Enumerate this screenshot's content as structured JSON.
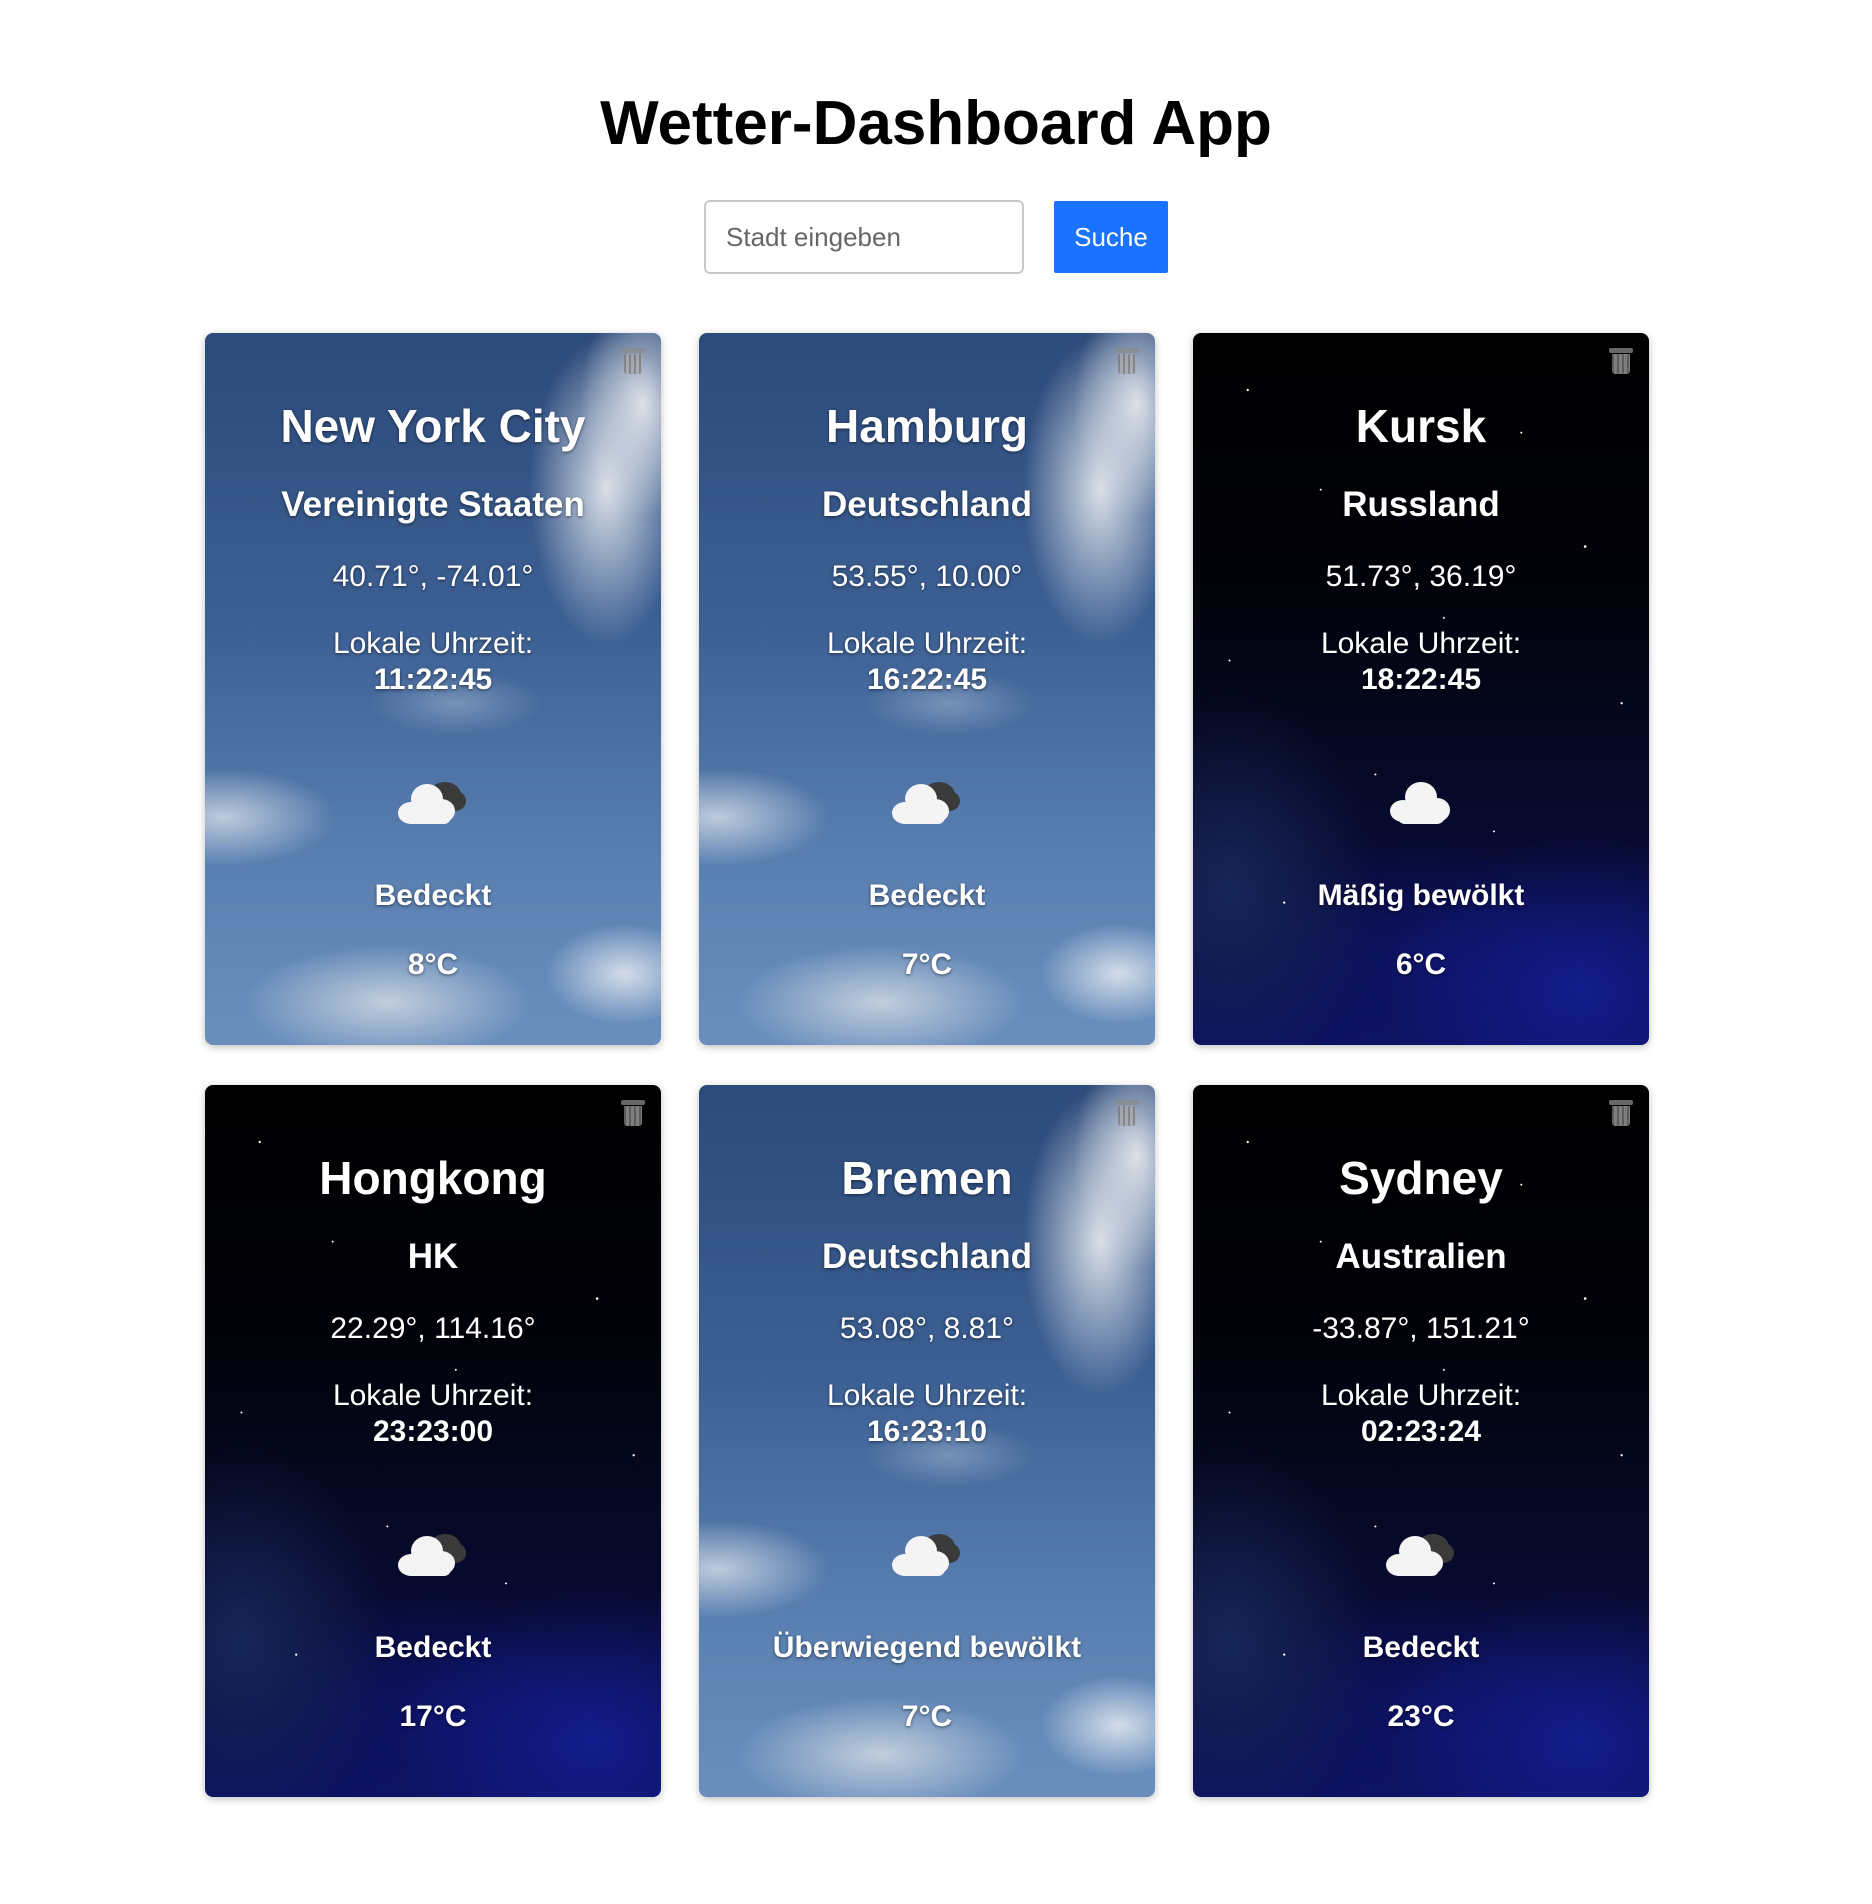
{
  "app": {
    "title": "Wetter-Dashboard App"
  },
  "search": {
    "placeholder": "Stadt eingeben",
    "value": "",
    "button_label": "Suche"
  },
  "colors": {
    "accent": "#1a73ff",
    "text_on_card": "#ffffff"
  },
  "cards": [
    {
      "city": "New York City",
      "country": "Vereinigte Staaten",
      "coords": "40.71°, -74.01°",
      "time_label": "Lokale Uhrzeit:",
      "time": "11:22:45",
      "condition": "Bedeckt",
      "temperature": "8°C",
      "background": "day-clouds",
      "icon": "overcast-cloud-icon"
    },
    {
      "city": "Hamburg",
      "country": "Deutschland",
      "coords": "53.55°, 10.00°",
      "time_label": "Lokale Uhrzeit:",
      "time": "16:22:45",
      "condition": "Bedeckt",
      "temperature": "7°C",
      "background": "day-clouds",
      "icon": "overcast-cloud-icon"
    },
    {
      "city": "Kursk",
      "country": "Russland",
      "coords": "51.73°, 36.19°",
      "time_label": "Lokale Uhrzeit:",
      "time": "18:22:45",
      "condition": "Mäßig bewölkt",
      "temperature": "6°C",
      "background": "night-stars",
      "icon": "cloud-icon"
    },
    {
      "city": "Hongkong",
      "country": "HK",
      "coords": "22.29°, 114.16°",
      "time_label": "Lokale Uhrzeit:",
      "time": "23:23:00",
      "condition": "Bedeckt",
      "temperature": "17°C",
      "background": "night-stars",
      "icon": "overcast-cloud-icon"
    },
    {
      "city": "Bremen",
      "country": "Deutschland",
      "coords": "53.08°, 8.81°",
      "time_label": "Lokale Uhrzeit:",
      "time": "16:23:10",
      "condition": "Überwiegend bewölkt",
      "temperature": "7°C",
      "background": "day-clouds",
      "icon": "overcast-cloud-icon"
    },
    {
      "city": "Sydney",
      "country": "Australien",
      "coords": "-33.87°, 151.21°",
      "time_label": "Lokale Uhrzeit:",
      "time": "02:23:24",
      "condition": "Bedeckt",
      "temperature": "23°C",
      "background": "night-stars",
      "icon": "overcast-cloud-icon"
    }
  ]
}
